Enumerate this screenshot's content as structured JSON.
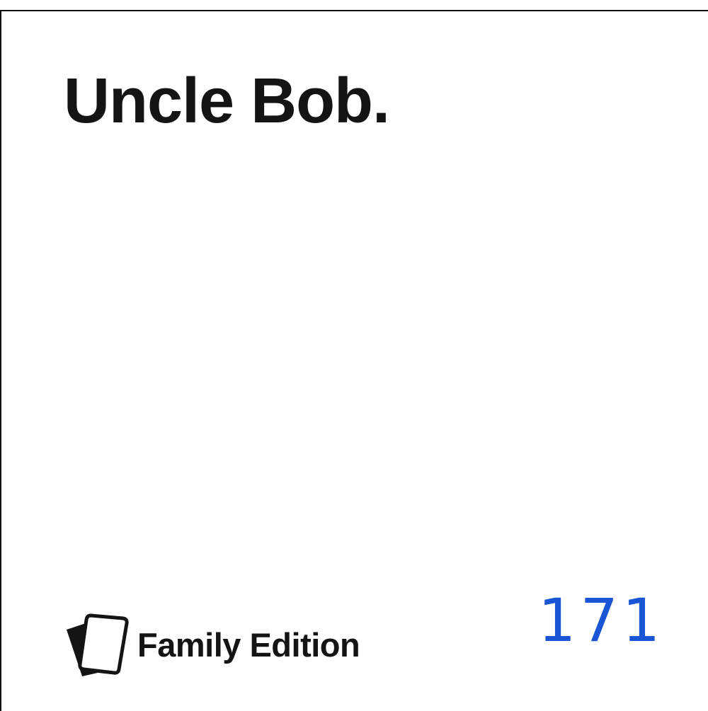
{
  "card": {
    "title": "Uncle Bob.",
    "number": "171",
    "number_color": "#1a55d6"
  },
  "brand": {
    "logo_icon": "stacked-cards-icon",
    "name": "Family Edition"
  }
}
